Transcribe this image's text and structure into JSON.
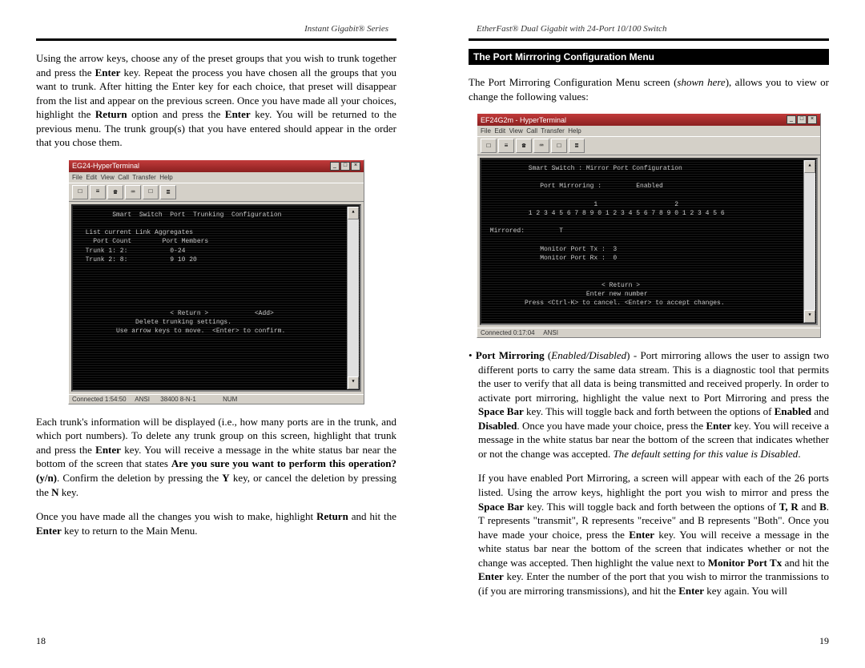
{
  "left": {
    "header": "Instant Gigabit® Series",
    "para1_parts": [
      "Using the arrow keys, choose any of the preset groups that you wish to trunk together and press the ",
      "Enter",
      " key.  Repeat the process you have chosen all the groups that you want to trunk.  After hitting the Enter key for each choice, that preset will disappear from the list and appear on the previous screen.  Once you have made all your choices, highlight the ",
      "Return",
      " option and press the ",
      "Enter",
      " key.  You will be returned to the previous menu.  The trunk group(s) that you have entered should appear in the order that you chose them."
    ],
    "fig": {
      "title": "EG24-HyperTerminal",
      "menu": "File  Edit  View  Call  Transfer  Help",
      "content": "         Smart  Switch  Port  Trunking  Configuration\n\n  List current Link Aggregates\n    Port Count        Port Members\n  Trunk 1: 2:           0-24\n  Trunk 2: 8:           9 10 20\n\n\n\n\n\n                        < Return >            <Add>\n               Delete trunking settings.\n          Use arrow keys to move.  <Enter> to confirm.",
      "status": "Connected 1:54:50     ANSI      38400 8-N-1               NUM"
    },
    "para2_parts": [
      "Each trunk's information will be displayed (i.e., how many ports are in the trunk, and which port numbers).  To delete any trunk group on this screen, highlight that trunk and press the ",
      "Enter",
      " key.  You will receive a message in the white status bar near the bottom of the screen that states ",
      "Are you sure you want to perform this operation? (y/n)",
      ".    Confirm the deletion by pressing the ",
      "Y",
      " key, or cancel the deletion by pressing the ",
      "N",
      " key."
    ],
    "para3_parts": [
      "Once you have made all the changes you wish to make, highlight ",
      "Return",
      " and hit the ",
      "Enter",
      " key to return to the Main Menu."
    ],
    "page_num": "18"
  },
  "right": {
    "header": "EtherFast® Dual Gigabit with 24-Port 10/100 Switch",
    "section_title": "The Port Mirrroring Configuration Menu",
    "intro_parts": [
      "The Port Mirroring Configuration Menu screen (",
      "shown here",
      "), allows you to view or change the following values:"
    ],
    "fig": {
      "title": "EF24G2m - HyperTerminal",
      "menu": "File  Edit  View  Call  Transfer  Help",
      "content": "           Smart Switch : Mirror Port Configuration\n\n              Port Mirroring :         Enabled\n\n                            1                    2\n           1 2 3 4 5 6 7 8 9 0 1 2 3 4 5 6 7 8 9 0 1 2 3 4 5 6\n\n Mirrored:         T\n\n              Monitor Port Tx :  3\n              Monitor Port Rx :  0\n\n\n                              < Return >\n                          Enter new number\n          Press <Ctrl-K> to cancel. <Enter> to accept changes.",
      "status": "Connected 0:17:04     ANSI"
    },
    "bullet_parts": [
      "• ",
      "Port Mirroring",
      " (",
      "Enabled/Disabled",
      ") - Port mirroring allows the user to assign two different ports to carry the same data stream.  This is a diagnostic tool that permits the user to verify that all data is being transmitted and received properly.  In order to activate port mirroring, highlight the value next to Port Mirroring and press the ",
      "Space Bar",
      " key.  This will toggle back and forth between the options of ",
      "Enabled",
      " and ",
      "Disabled",
      ".  Once you have made your choice, press the ",
      "Enter",
      " key.  You will receive a message in the white status bar near the bottom of the screen that indicates whether or not the change was accepted.  ",
      "The default setting for this value is Disabled",
      "."
    ],
    "para4_parts": [
      "If you have enabled Port Mirroring, a screen will appear with each of the 26 ports listed.  Using the arrow keys, highlight the port you wish to mirror and press the ",
      "Space Bar",
      " key.  This will toggle back and forth between the options of ",
      "T, R",
      " and ",
      "B",
      ".  T represents \"transmit\", R represents \"receive\" and B represents \"Both\".  Once you have made your choice, press the ",
      "Enter",
      " key.  You will receive a message in the white status bar near the bottom of the screen that indicates whether or not the change was accepted. Then highlight the value next to ",
      "Monitor Port Tx",
      " and hit the ",
      "Enter",
      " key. Enter the number of the port that you wish to mirror the tranmissions to (if you are mirroring transmissions), and hit the ",
      "Enter",
      " key again.  You will"
    ],
    "page_num": "19"
  }
}
